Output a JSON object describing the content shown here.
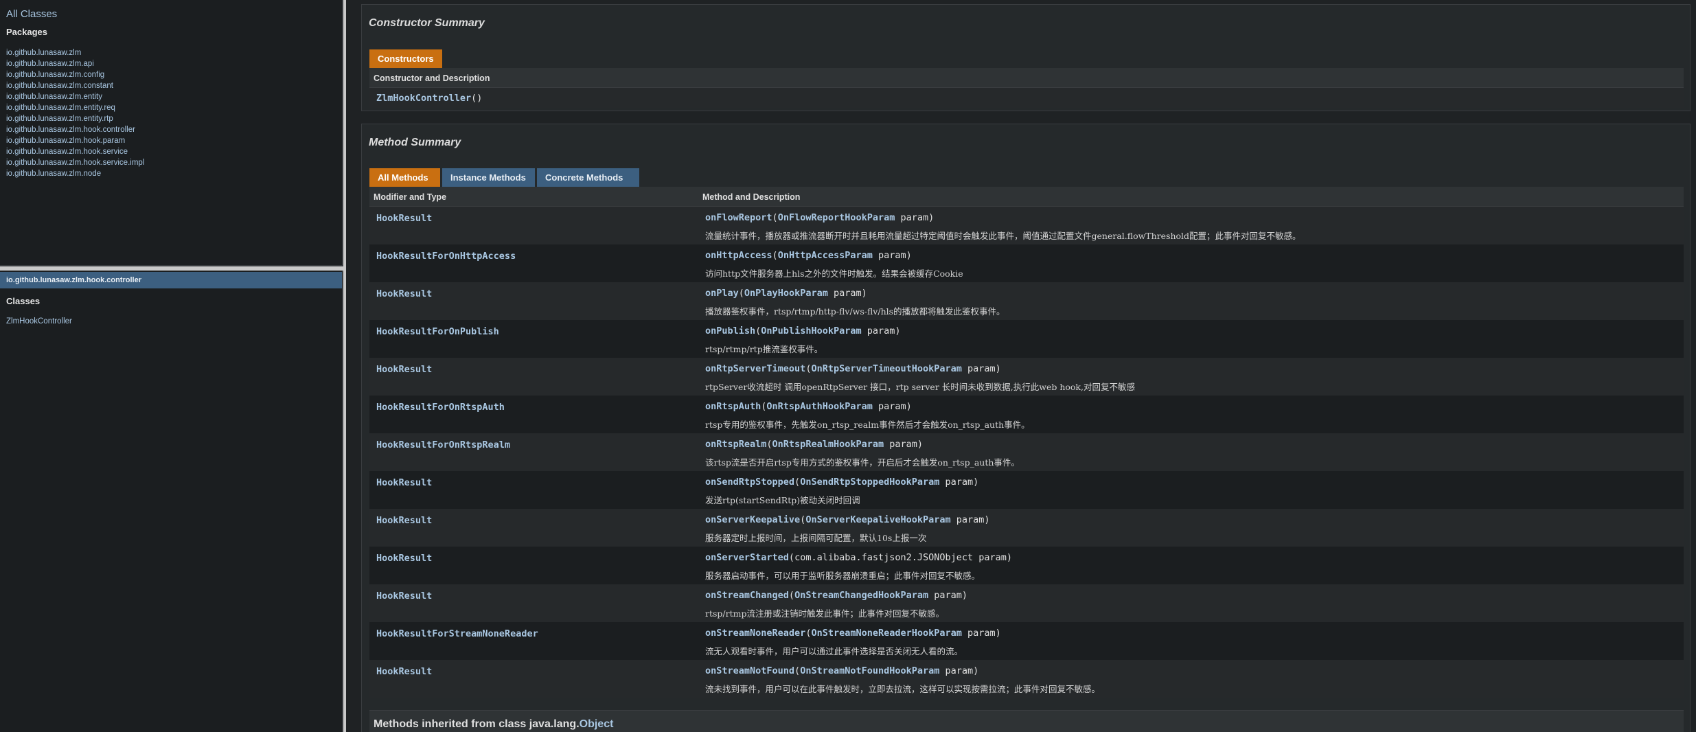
{
  "left_nav": {
    "all_classes": "All Classes",
    "packages_title": "Packages",
    "packages": [
      "io.github.lunasaw.zlm",
      "io.github.lunasaw.zlm.api",
      "io.github.lunasaw.zlm.config",
      "io.github.lunasaw.zlm.constant",
      "io.github.lunasaw.zlm.entity",
      "io.github.lunasaw.zlm.entity.req",
      "io.github.lunasaw.zlm.entity.rtp",
      "io.github.lunasaw.zlm.hook.controller",
      "io.github.lunasaw.zlm.hook.param",
      "io.github.lunasaw.zlm.hook.service",
      "io.github.lunasaw.zlm.hook.service.impl",
      "io.github.lunasaw.zlm.node"
    ],
    "package_header": "io.github.lunasaw.zlm.hook.controller",
    "classes_title": "Classes",
    "classes": [
      "ZlmHookController"
    ]
  },
  "constructor_summary": {
    "title": "Constructor Summary",
    "tab": "Constructors",
    "column_header": "Constructor and Description",
    "name": "ZlmHookController",
    "params": "()"
  },
  "method_summary": {
    "title": "Method Summary",
    "tabs": [
      "All Methods",
      "Instance Methods",
      "Concrete Methods"
    ],
    "columns": [
      "Modifier and Type",
      "Method and Description"
    ],
    "rows": [
      {
        "type": "HookResult",
        "method": "onFlowReport",
        "open": "(",
        "param_type": "OnFlowReportHookParam",
        "rest": " param)",
        "desc": "流量统计事件，播放器或推流器断开时并且耗用流量超过特定阈值时会触发此事件，阈值通过配置文件general.flowThreshold配置；此事件对回复不敏感。"
      },
      {
        "type": "HookResultForOnHttpAccess",
        "method": "onHttpAccess",
        "open": "(",
        "param_type": "OnHttpAccessParam",
        "rest": " param)",
        "desc": "访问http文件服务器上hls之外的文件时触发。结果会被缓存Cookie"
      },
      {
        "type": "HookResult",
        "method": "onPlay",
        "open": "(",
        "param_type": "OnPlayHookParam",
        "rest": " param)",
        "desc": "播放器鉴权事件，rtsp/rtmp/http-flv/ws-flv/hls的播放都将触发此鉴权事件。"
      },
      {
        "type": "HookResultForOnPublish",
        "method": "onPublish",
        "open": "(",
        "param_type": "OnPublishHookParam",
        "rest": " param)",
        "desc": "rtsp/rtmp/rtp推流鉴权事件。"
      },
      {
        "type": "HookResult",
        "method": "onRtpServerTimeout",
        "open": "(",
        "param_type": "OnRtpServerTimeoutHookParam",
        "rest": " param)",
        "desc": "rtpServer收流超时 调用openRtpServer 接口，rtp server 长时间未收到数据,执行此web hook,对回复不敏感"
      },
      {
        "type": "HookResultForOnRtspAuth",
        "method": "onRtspAuth",
        "open": "(",
        "param_type": "OnRtspAuthHookParam",
        "rest": " param)",
        "desc": "rtsp专用的鉴权事件，先触发on_rtsp_realm事件然后才会触发on_rtsp_auth事件。"
      },
      {
        "type": "HookResultForOnRtspRealm",
        "method": "onRtspRealm",
        "open": "(",
        "param_type": "OnRtspRealmHookParam",
        "rest": " param)",
        "desc": "该rtsp流是否开启rtsp专用方式的鉴权事件，开启后才会触发on_rtsp_auth事件。"
      },
      {
        "type": "HookResult",
        "method": "onSendRtpStopped",
        "open": "(",
        "param_type": "OnSendRtpStoppedHookParam",
        "rest": " param)",
        "desc": "发送rtp(startSendRtp)被动关闭时回调"
      },
      {
        "type": "HookResult",
        "method": "onServerKeepalive",
        "open": "(",
        "param_type": "OnServerKeepaliveHookParam",
        "rest": " param)",
        "desc": "服务器定时上报时间，上报间隔可配置，默认10s上报一次"
      },
      {
        "type": "HookResult",
        "method": "onServerStarted",
        "open": "(",
        "param_type": "",
        "rest": "com.alibaba.fastjson2.JSONObject param)",
        "desc": "服务器启动事件，可以用于监听服务器崩溃重启；此事件对回复不敏感。"
      },
      {
        "type": "HookResult",
        "method": "onStreamChanged",
        "open": "(",
        "param_type": "OnStreamChangedHookParam",
        "rest": " param)",
        "desc": "rtsp/rtmp流注册或注销时触发此事件；此事件对回复不敏感。"
      },
      {
        "type": "HookResultForStreamNoneReader",
        "method": "onStreamNoneReader",
        "open": "(",
        "param_type": "OnStreamNoneReaderHookParam",
        "rest": " param)",
        "desc": "流无人观看时事件，用户可以通过此事件选择是否关闭无人看的流。"
      },
      {
        "type": "HookResult",
        "method": "onStreamNotFound",
        "open": "(",
        "param_type": "OnStreamNotFoundHookParam",
        "rest": " param)",
        "desc": "流未找到事件，用户可以在此事件触发时，立即去拉流，这样可以实现按需拉流；此事件对回复不敏感。"
      }
    ]
  },
  "inherited": {
    "prefix": "Methods inherited from class java.lang.",
    "link": "Object"
  }
}
